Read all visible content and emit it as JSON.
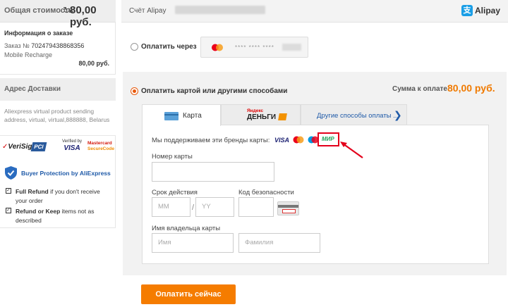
{
  "summary": {
    "total_label": "Общая стоимость",
    "total_amount": "80,00 руб.",
    "order_info_title": "Информация о заказе",
    "order_no_label": "Заказ №",
    "order_no": "702479438868356",
    "item_name": "Mobile Recharge",
    "item_amount": "80,00 руб."
  },
  "address": {
    "title": "Адрес Доставки",
    "text": "Aliexpress virtual product sending address, virtual, virtual,888888, Belarus"
  },
  "security_logos": {
    "verisign": "VeriSign",
    "pci": "PCI",
    "vbv_top": "Verified by",
    "vbv_visa": "VISA",
    "mc_top": "Mastercard",
    "mc_bottom": "SecureCode"
  },
  "buyer_protection": {
    "title": "Buyer Protection by AliExpress",
    "full_refund_bold": "Full Refund",
    "full_refund_text": " if you don't receive your order",
    "refund_keep_bold": "Refund or Keep",
    "refund_keep_text": " items not as described"
  },
  "account": {
    "label": "Счёт Alipay",
    "brand": "Alipay",
    "brand_color": "#1a9ee6"
  },
  "saved_method": {
    "label": "Оплатить через",
    "masked_number": "**** **** ****"
  },
  "card_payment": {
    "label": "Оплатить картой или другими способами",
    "sum_label": "Сумма к оплате",
    "sum_value": "80,00 руб.",
    "accent_color": "#f07a00"
  },
  "tabs": {
    "card": "Карта",
    "yandex_top": "Яндекс",
    "yandex_bottom": "ДЕНЬГИ",
    "other": "Другие способы оплаты ..."
  },
  "form": {
    "brands_label": "Мы поддерживаем эти бренды карты:",
    "brand_visa": "VISA",
    "brand_mir": "МИР",
    "card_number_label": "Номер карты",
    "expiry_label": "Срок действия",
    "expiry_mm_placeholder": "MM",
    "expiry_separator": "/",
    "expiry_yy_placeholder": "YY",
    "cvv_label": "Код безопасности",
    "holder_label": "Имя владельца карты",
    "first_name_placeholder": "Имя",
    "last_name_placeholder": "Фамилия"
  },
  "actions": {
    "pay_now": "Оплатить сейчас"
  },
  "icons": [
    "refresh-icon",
    "shield-icon",
    "checkbox-icon",
    "mastercard-icon",
    "maestro-icon",
    "card-icon",
    "chevron-right-icon",
    "cvv-card-icon",
    "red-arrow-icon"
  ]
}
